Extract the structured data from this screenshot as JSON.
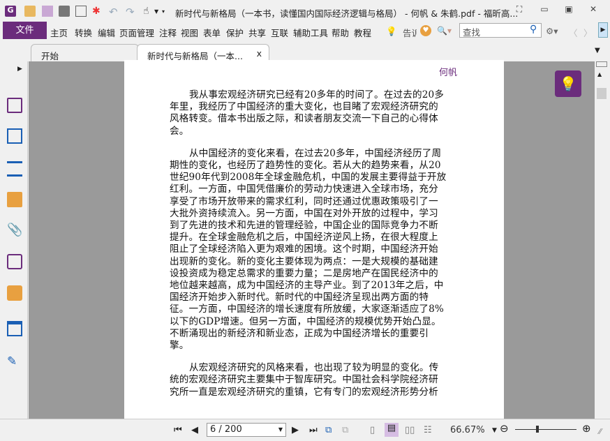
{
  "window": {
    "title": "新时代与新格局（一本书，读懂国内国际经济逻辑与格局） - 何帆 & 朱鹤.pdf - 福昕高..."
  },
  "menu": {
    "file": "文件",
    "items": [
      "主页",
      "转换",
      "编辑",
      "页面管理",
      "注释",
      "视图",
      "表单",
      "保护",
      "共享",
      "互联",
      "辅助工具",
      "帮助",
      "教程"
    ],
    "tell": "告诉",
    "search_placeholder": "查找"
  },
  "tabs": [
    {
      "label": "开始"
    },
    {
      "label": "新时代与新格局（一本...",
      "close": "x"
    }
  ],
  "document": {
    "header": "何帆",
    "lines": [
      "我从事宏观经济研究已经有20多年的时间了。在过去的20多",
      "年里，我经历了中国经济的重大变化，也目睹了宏观经济研究的",
      "风格转变。借本书出版之际，和读者朋友交流一下自己的心得体",
      "会。",
      "从中国经济的变化来看，在过去20多年，中国经济经历了周",
      "期性的变化，也经历了趋势性的变化。若从大的趋势来看，从20",
      "世纪90年代到2008年全球金融危机，中国的发展主要得益于开放",
      "红利。一方面，中国凭借廉价的劳动力快速进入全球市场，充分",
      "享受了市场开放带来的需求红利，同时还通过优惠政策吸引了一",
      "大批外资持续流入。另一方面，中国在对外开放的过程中，学习",
      "到了先进的技术和先进的管理经验，中国企业的国际竞争力不断",
      "提升。在全球金融危机之后，中国经济逆风上扬，在很大程度上",
      "阻止了全球经济陷入更为艰难的困境。这个时期，中国经济开始",
      "出现新的变化。新的变化主要体现为两点：一是大规模的基础建",
      "设投资成为稳定总需求的重要力量；二是房地产在国民经济中的",
      "地位越来越高，成为中国经济的主导产业。到了2013年之后，中",
      "国经济开始步入新时代。新时代的中国经济呈现出两方面的特",
      "征。一方面，中国经济的增长速度有所放缓，大家逐渐适应了8%",
      "以下的GDP增速。但另一方面，中国经济的规模优势开始凸显。",
      "不断涌现出的新经济和新业态，正成为中国经济增长的重要引",
      "擎。",
      "从宏观经济研究的风格来看，也出现了较为明显的变化。传",
      "统的宏观经济研究主要集中于智库研究。中国社会科学院经济研",
      "究所一直是宏观经济研究的重镇，它有专门的宏观经济形势分析"
    ]
  },
  "status": {
    "page": "6 / 200",
    "zoom": "66.67%"
  },
  "colors": {
    "accent": "#6b2c7c",
    "header": "#6b2c7c"
  }
}
